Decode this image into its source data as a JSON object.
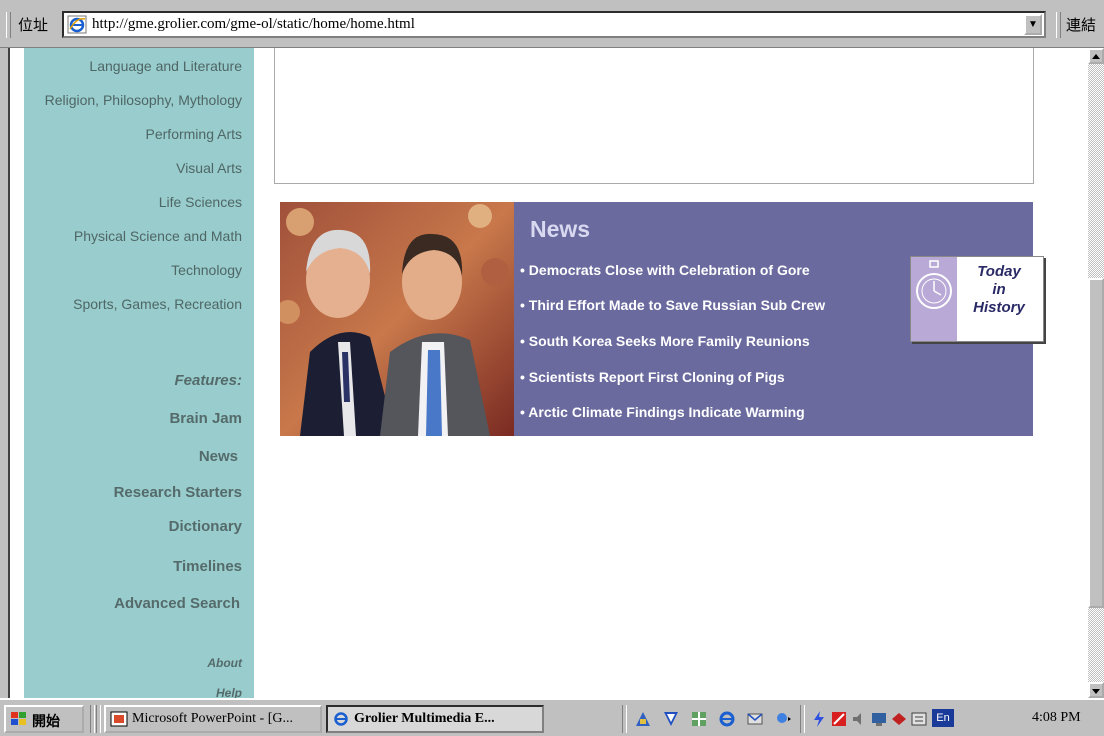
{
  "address_bar": {
    "label": "位址",
    "url": "http://gme.grolier.com/gme-ol/static/home/home.html",
    "links_label": "連結"
  },
  "sidebar": {
    "subjects": [
      "Language and Literature",
      "Religion, Philosophy, Mythology",
      "Performing Arts",
      "Visual Arts",
      "Life Sciences",
      "Physical Science and Math",
      "Technology",
      "Sports, Games, Recreation"
    ],
    "features_heading": "Features:",
    "features": [
      "Brain Jam",
      "News",
      "Research Starters",
      "Dictionary",
      "Timelines",
      "Advanced Search"
    ],
    "about": "About",
    "help": "Help"
  },
  "news": {
    "title": "News",
    "headlines": [
      "• Democrats Close with Celebration of Gore",
      "• Third Effort Made to Save Russian Sub Crew",
      "• South Korea Seeks More Family Reunions",
      "• Scientists Report First Cloning of Pigs",
      "• Arctic Climate Findings Indicate Warming"
    ],
    "today_in_history": [
      "Today",
      "in",
      "History"
    ]
  },
  "taskbar": {
    "start_label": "開始",
    "tasks": [
      {
        "label": "Microsoft PowerPoint - [G...",
        "active": false
      },
      {
        "label": "Grolier Multimedia E...",
        "active": true
      }
    ],
    "lang_indicator": "En",
    "clock": "4:08 PM"
  },
  "colors": {
    "sidebar_bg": "#99cccc",
    "news_bg": "#6a6a9f",
    "chrome": "#c0c0c0"
  }
}
